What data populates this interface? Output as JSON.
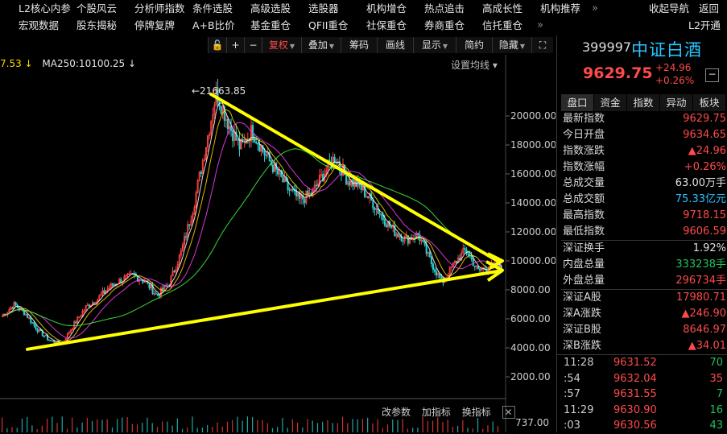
{
  "nav": {
    "row1": [
      "L2核心内参",
      "个股风云",
      "分析师指数",
      "条件选股",
      "高级选股",
      "选股器",
      "机构增仓",
      "热点追击",
      "高成长性",
      "机构推荐"
    ],
    "row2": [
      "宏观数据",
      "股东揭秘",
      "停牌复牌",
      "A+B比价",
      "基金重仓",
      "QFII重仓",
      "社保重仓",
      "券商重仓",
      "信托重仓"
    ],
    "more": "»",
    "right1": [
      "收起导航",
      "返回"
    ],
    "right2": "L2开通"
  },
  "toolbar": {
    "lock": "🔓",
    "plus": "+",
    "minus": "−",
    "fuquan": "复权",
    "diejia": "叠加",
    "choumа": "筹码",
    "huaxian": "画线",
    "xianshi": "显示",
    "jianyue": "简约",
    "yincang": "隐藏",
    "expand": "⛶"
  },
  "chart": {
    "ma_legend_prefix": "7.53 ↓",
    "ma_legend": "MA250:10100.25 ↓",
    "settings_label": "设置均线 ▾",
    "peak_label": "←21663.85",
    "y_ticks": [
      "20000.00",
      "18000.00",
      "16000.00",
      "14000.00",
      "12000.00",
      "10000.00",
      "8000.00",
      "6000.00",
      "4000.00",
      "2000.00"
    ],
    "bottom_tools": [
      "改参数",
      "加指标",
      "换指标"
    ],
    "volume_label": "737.00",
    "colors": {
      "trendline": "#ffff00",
      "up": "#ff4040",
      "down": "#28d0d0",
      "ma5": "#ffffff",
      "ma10": "#ffd800",
      "ma20": "#ff40ff",
      "ma60": "#40ff40"
    }
  },
  "chart_data": {
    "type": "line",
    "title": "",
    "ylim": [
      0,
      22000
    ],
    "y_ticks": [
      2000,
      4000,
      6000,
      8000,
      10000,
      12000,
      14000,
      16000,
      18000,
      20000
    ],
    "series": [
      {
        "name": "",
        "values": [
          6200,
          7000,
          6300,
          5200,
          4500,
          4300,
          5600,
          6800,
          7400,
          8200,
          8700,
          9000,
          8600,
          7600,
          8400,
          10500,
          13500,
          17500,
          21663,
          19500,
          17800,
          19000,
          17500,
          16200,
          15000,
          14200,
          14600,
          16000,
          17200,
          15600,
          15200,
          14200,
          13000,
          12000,
          11500,
          11800,
          10000,
          8500,
          9800,
          10800,
          9300,
          9600,
          9630
        ]
      }
    ],
    "annotations": [
      "21663.85"
    ]
  },
  "panel": {
    "code": "399997",
    "name": "中证白酒",
    "price": "9629.75",
    "change": "+24.96",
    "change_pct": "+0.26%",
    "collapse": "−",
    "tabs": [
      "盘口",
      "资金",
      "指数",
      "异动",
      "板块"
    ],
    "rows": [
      {
        "label": "最新指数",
        "value": "9629.75",
        "cls": "red"
      },
      {
        "label": "今日开盘",
        "value": "9634.65",
        "cls": "red"
      },
      {
        "label": "指数涨跌",
        "value": "▲24.96",
        "cls": "red"
      },
      {
        "label": "指数涨幅",
        "value": "+0.26%",
        "cls": "red"
      },
      {
        "label": "总成交量",
        "value": "63.00万手",
        "cls": ""
      },
      {
        "label": "总成交额",
        "value": "75.33亿元",
        "cls": "cyan"
      },
      {
        "label": "最高指数",
        "value": "9718.15",
        "cls": "red"
      },
      {
        "label": "最低指数",
        "value": "9606.59",
        "cls": "red"
      }
    ],
    "rows2": [
      {
        "label": "深证换手",
        "value": "1.92%",
        "cls": ""
      },
      {
        "label": "内盘总量",
        "value": "333238手",
        "cls": "green"
      },
      {
        "label": "外盘总量",
        "value": "296734手",
        "cls": "red"
      }
    ],
    "rows3": [
      {
        "label": "深证A股",
        "value": "17980.71",
        "cls": "red"
      },
      {
        "label": "深A涨跌",
        "value": "▲246.90",
        "cls": "red"
      },
      {
        "label": "深证B股",
        "value": "8646.97",
        "cls": "red"
      },
      {
        "label": "深B涨跌",
        "value": "▲34.01",
        "cls": "red"
      }
    ],
    "ticks": [
      {
        "time": "11:28",
        "price": "9631.52",
        "vol": "70",
        "cls": "green"
      },
      {
        "time": ":54",
        "price": "9632.04",
        "vol": "35",
        "cls": "red"
      },
      {
        "time": ":57",
        "price": "9631.55",
        "vol": "7",
        "cls": "green"
      },
      {
        "time": "11:29",
        "price": "9630.90",
        "vol": "16",
        "cls": "green"
      },
      {
        "time": ":03",
        "price": "9630.56",
        "vol": "43",
        "cls": "green"
      }
    ]
  }
}
